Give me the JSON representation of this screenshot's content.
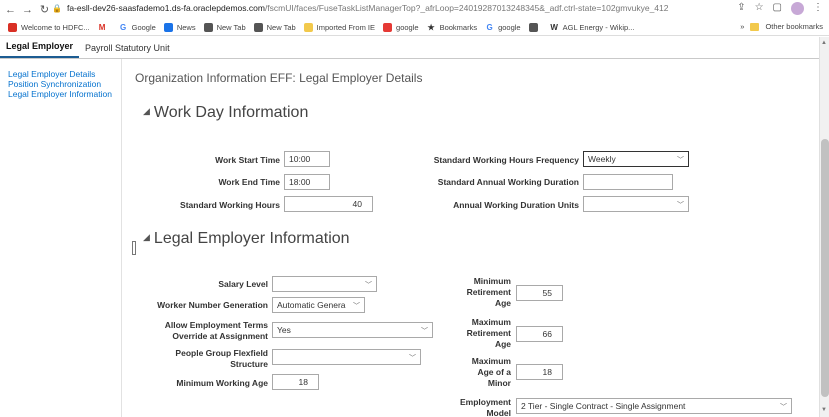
{
  "browser": {
    "url_host": "fa-esll-dev26-saasfademo1.ds-fa.oraclepdemos.com",
    "url_path": "/fscmUI/faces/FuseTaskListManagerTop?_afrLoop=24019287013248345&_adf.ctrl-state=102gmvukye_412"
  },
  "bookmarks": [
    {
      "label": "Welcome to HDFC...",
      "color": "#d93025"
    },
    {
      "label": "",
      "color": "#d93025",
      "glyph": "M"
    },
    {
      "label": "Google",
      "color": "#4285f4",
      "glyph": "G"
    },
    {
      "label": "News",
      "color": "#1a73e8"
    },
    {
      "label": "New Tab",
      "color": "#555555"
    },
    {
      "label": "New Tab",
      "color": "#555555"
    },
    {
      "label": "Imported From IE",
      "color": "#f2c94c"
    },
    {
      "label": "google",
      "color": "#e53935"
    },
    {
      "label": "Bookmarks",
      "color": "#333333",
      "glyph": "★"
    },
    {
      "label": "google",
      "color": "#4285f4",
      "glyph": "G"
    },
    {
      "label": "",
      "color": "#555555"
    },
    {
      "label": "AGL Energy - Wikip...",
      "color": "#333333",
      "glyph": "W"
    }
  ],
  "bookmarks_more": "»",
  "other_bookmarks": "Other bookmarks",
  "tabs": [
    "Legal Employer",
    "Payroll Statutory Unit"
  ],
  "leftnav": [
    "Legal Employer Details",
    "Position Synchronization",
    "Legal Employer Information"
  ],
  "page_title": "Organization Information EFF: Legal Employer Details",
  "work_day": {
    "heading": "Work Day Information",
    "start_time_label": "Work Start Time",
    "start_time": "10:00",
    "end_time_label": "Work End Time",
    "end_time": "18:00",
    "std_hours_label": "Standard Working Hours",
    "std_hours": "40",
    "freq_label": "Standard Working Hours Frequency",
    "freq": "Weekly",
    "annual_label": "Standard Annual Working Duration",
    "annual": "",
    "units_label": "Annual Working Duration Units",
    "units": ""
  },
  "legal_employer": {
    "heading": "Legal Employer Information",
    "salary_level_label": "Salary Level",
    "salary_level": "",
    "worker_num_label": "Worker Number Generation",
    "worker_num": "Automatic Genera",
    "allow_override_label_1": "Allow Employment Terms",
    "allow_override_label_2": "Override at Assignment",
    "allow_override": "Yes",
    "people_group_label_1": "People Group Flexfield",
    "people_group_label_2": "Structure",
    "people_group": "",
    "min_working_age_label": "Minimum Working Age",
    "min_working_age": "18",
    "min_retire_label": [
      "Minimum",
      "Retirement",
      "Age"
    ],
    "min_retire": "55",
    "max_retire_label": [
      "Maximum",
      "Retirement",
      "Age"
    ],
    "max_retire": "66",
    "max_minor_label": [
      "Maximum",
      "Age of a",
      "Minor"
    ],
    "max_minor": "18",
    "emp_model_label": [
      "Employment",
      "Model"
    ],
    "emp_model": "2 Tier - Single Contract - Single Assignment"
  }
}
